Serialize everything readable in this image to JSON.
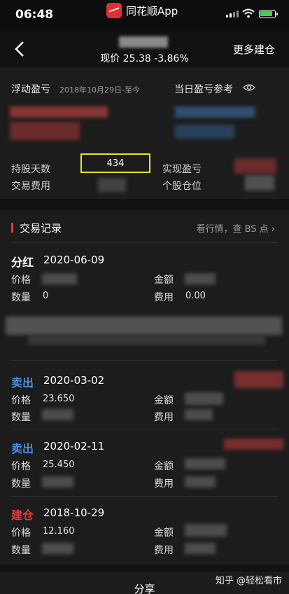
{
  "status_bar": {
    "time": "06:48",
    "app_name": "同花顺App"
  },
  "header": {
    "price_text": "现价 25.38 -3.86%",
    "more_button": "更多建仓"
  },
  "summary": {
    "floating_pl_label": "浮动盈亏",
    "date_range": "2018年10月29日-至今",
    "daily_pl_label": "当日盈亏参考",
    "holding_days_label": "持股天数",
    "holding_days_value": "434",
    "realized_pl_label": "实现盈亏",
    "fee_label": "交易费用",
    "position_label": "个股仓位"
  },
  "records": {
    "title": "交易记录",
    "link": "看行情，查 BS 点",
    "price_label": "价格",
    "qty_label": "数量",
    "amount_label": "金额",
    "fee_label": "费用",
    "items": [
      {
        "type": "分红",
        "date": "2020-06-09",
        "price": "",
        "qty": "0",
        "amount": "",
        "fee": "0.00"
      },
      {
        "type": "卖出",
        "date": "2020-03-02",
        "price": "23.650",
        "qty": "",
        "amount": "",
        "fee": ""
      },
      {
        "type": "卖出",
        "date": "2020-02-11",
        "price": "25.450",
        "qty": "",
        "amount": "",
        "fee": ""
      },
      {
        "type": "建仓",
        "date": "2018-10-29",
        "price": "12.160",
        "qty": "",
        "amount": "",
        "fee": ""
      }
    ]
  },
  "footer": {
    "share": "分享",
    "watermark": "知乎 @轻松看市"
  },
  "colors": {
    "accent_red": "#e23b3b",
    "sell_blue": "#4a8fe0",
    "highlight": "#f2e02a"
  }
}
